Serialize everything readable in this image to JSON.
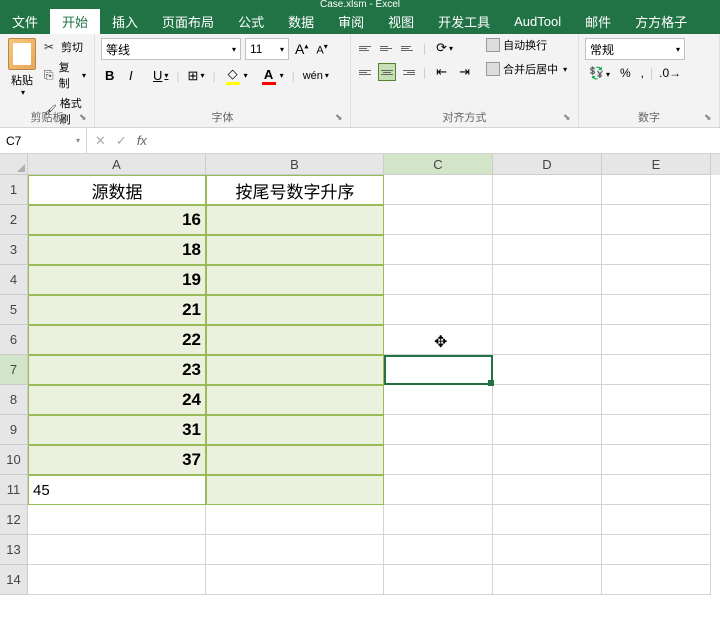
{
  "title": "Case.xlsm - Excel",
  "tabs": {
    "file": "文件",
    "home": "开始",
    "insert": "插入",
    "layout": "页面布局",
    "formula": "公式",
    "data": "数据",
    "review": "审阅",
    "view": "视图",
    "dev": "开发工具",
    "aud": "AudTool",
    "mail": "邮件",
    "fgz": "方方格子"
  },
  "ribbon": {
    "clipboard": {
      "label": "剪贴板",
      "paste": "粘贴",
      "cut": "剪切",
      "copy": "复制",
      "brush": "格式刷"
    },
    "font": {
      "label": "字体",
      "name": "等线",
      "size": "11",
      "bold": "B",
      "italic": "I",
      "underline": "U",
      "wen": "wén"
    },
    "align": {
      "label": "对齐方式",
      "wrap": "自动换行",
      "merge": "合并后居中"
    },
    "number": {
      "label": "数字",
      "format": "常规",
      "percent": "%",
      "comma": ","
    }
  },
  "namebox": "C7",
  "columns": [
    "A",
    "B",
    "C",
    "D",
    "E"
  ],
  "rows": [
    "1",
    "2",
    "3",
    "4",
    "5",
    "6",
    "7",
    "8",
    "9",
    "10",
    "11",
    "12",
    "13",
    "14"
  ],
  "headers": {
    "A": "源数据",
    "B": "按尾号数字升序"
  },
  "cellsA": [
    "16",
    "18",
    "19",
    "21",
    "22",
    "23",
    "24",
    "31",
    "37",
    "45"
  ],
  "selected": {
    "row": 7,
    "col": "C"
  },
  "cursor": {
    "row": 6,
    "col": "C"
  }
}
